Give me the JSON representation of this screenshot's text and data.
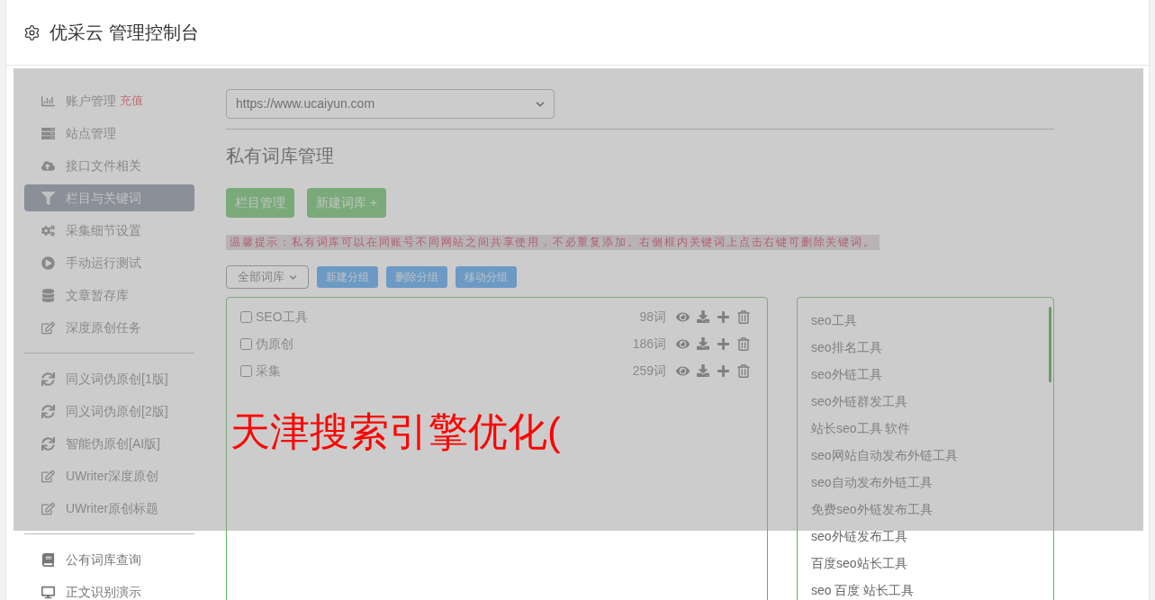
{
  "header": {
    "title": "优采云 管理控制台"
  },
  "sidebar": {
    "groups": [
      [
        {
          "label": "账户管理",
          "badge": "充值",
          "selected": false
        },
        {
          "label": "站点管理",
          "selected": false
        },
        {
          "label": "接口文件相关",
          "selected": false
        },
        {
          "label": "栏目与关键词",
          "selected": true
        },
        {
          "label": "采集细节设置",
          "selected": false
        },
        {
          "label": "手动运行测试",
          "selected": false
        },
        {
          "label": "文章暂存库",
          "selected": false
        },
        {
          "label": "深度原创任务",
          "selected": false
        }
      ],
      [
        {
          "label": "同义词伪原创[1版]",
          "selected": false
        },
        {
          "label": "同义词伪原创[2版]",
          "selected": false
        },
        {
          "label": "智能伪原创[AI版]",
          "selected": false
        },
        {
          "label": "UWriter深度原创",
          "selected": false
        },
        {
          "label": "UWriter原创标题",
          "selected": false
        }
      ],
      [
        {
          "label": "公有词库查询",
          "selected": false
        },
        {
          "label": "正文识别演示",
          "selected": false
        }
      ]
    ]
  },
  "site_select": {
    "value": "https://www.ucaiyun.com"
  },
  "heading": "私有词库管理",
  "action_buttons": [
    "栏目管理",
    "新建词库 +"
  ],
  "tip": "温馨提示：私有词库可以在同账号不同网站之间共享使用，不必重复添加。右侧框内关键词上点击右键可删除关键词。",
  "group_select": {
    "value": "全部词库"
  },
  "group_buttons": [
    "新建分组",
    "删除分组",
    "移动分组"
  ],
  "libraries": [
    {
      "name": "SEO工具",
      "count": "98词",
      "checked": false
    },
    {
      "name": "伪原创",
      "count": "186词",
      "checked": false
    },
    {
      "name": "采集",
      "count": "259词",
      "checked": false
    }
  ],
  "keywords": [
    "seo工具",
    "seo排名工具",
    "seo外链工具",
    "seo外链群发工具",
    "站长seo工具 软件",
    "seo网站自动发布外链工具",
    "seo自动发布外链工具",
    "免费seo外链发布工具",
    "seo外链发布工具",
    "百度seo站长工具",
    "seo 百度 站长工具"
  ],
  "mask": {
    "visible": true
  },
  "overlay_text": "天津搜索引擎优化("
}
